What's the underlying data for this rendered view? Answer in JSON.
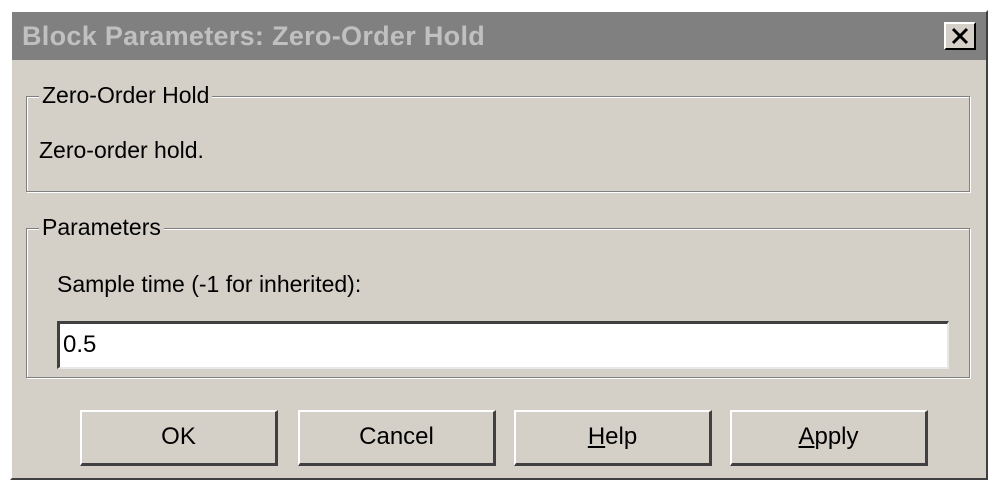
{
  "window": {
    "title": "Block Parameters: Zero-Order Hold",
    "close_glyph": "✕"
  },
  "block_group": {
    "legend": "Zero-Order Hold",
    "description": "Zero-order hold."
  },
  "params_group": {
    "legend": "Parameters",
    "sample_time_label": "Sample time (-1 for inherited):",
    "sample_time_value": "0.5"
  },
  "buttons": {
    "ok": "OK",
    "cancel": "Cancel",
    "help_mnemonic": "H",
    "help_rest": "elp",
    "apply_mnemonic": "A",
    "apply_rest": "pply"
  }
}
